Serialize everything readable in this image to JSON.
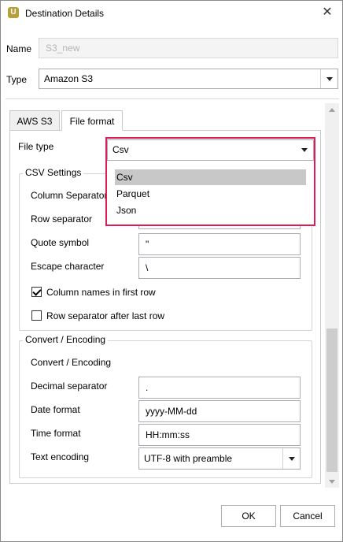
{
  "window": {
    "title": "Destination Details",
    "app_icon_letter": "U"
  },
  "name_field": {
    "label": "Name",
    "value": "S3_new"
  },
  "type_field": {
    "label": "Type",
    "value": "Amazon S3"
  },
  "tabs": [
    {
      "label": "AWS S3"
    },
    {
      "label": "File format"
    }
  ],
  "file_type": {
    "label": "File type",
    "value": "Csv",
    "options": [
      "Csv",
      "Parquet",
      "Json"
    ]
  },
  "csv_settings": {
    "title": "CSV Settings",
    "column_separator_label": "Column Separator",
    "row_separator_label": "Row separator",
    "quote_symbol_label": "Quote symbol",
    "quote_symbol_value": "\"",
    "escape_character_label": "Escape character",
    "escape_character_value": "\\",
    "column_names_label": "Column names in first row",
    "column_names_checked": true,
    "row_separator_after_label": "Row separator after last row",
    "row_separator_after_checked": false
  },
  "convert": {
    "title": "Convert / Encoding",
    "subheading": "Convert / Encoding",
    "decimal_separator_label": "Decimal separator",
    "decimal_separator_value": ".",
    "date_format_label": "Date format",
    "date_format_value": "yyyy-MM-dd",
    "time_format_label": "Time format",
    "time_format_value": "HH:mm:ss",
    "text_encoding_label": "Text encoding",
    "text_encoding_value": "UTF-8 with preamble"
  },
  "buttons": {
    "ok": "OK",
    "cancel": "Cancel"
  },
  "colors": {
    "highlight": "#e01a55",
    "selected_item": "#c8c8c8",
    "app_icon": "#b7a03a"
  }
}
